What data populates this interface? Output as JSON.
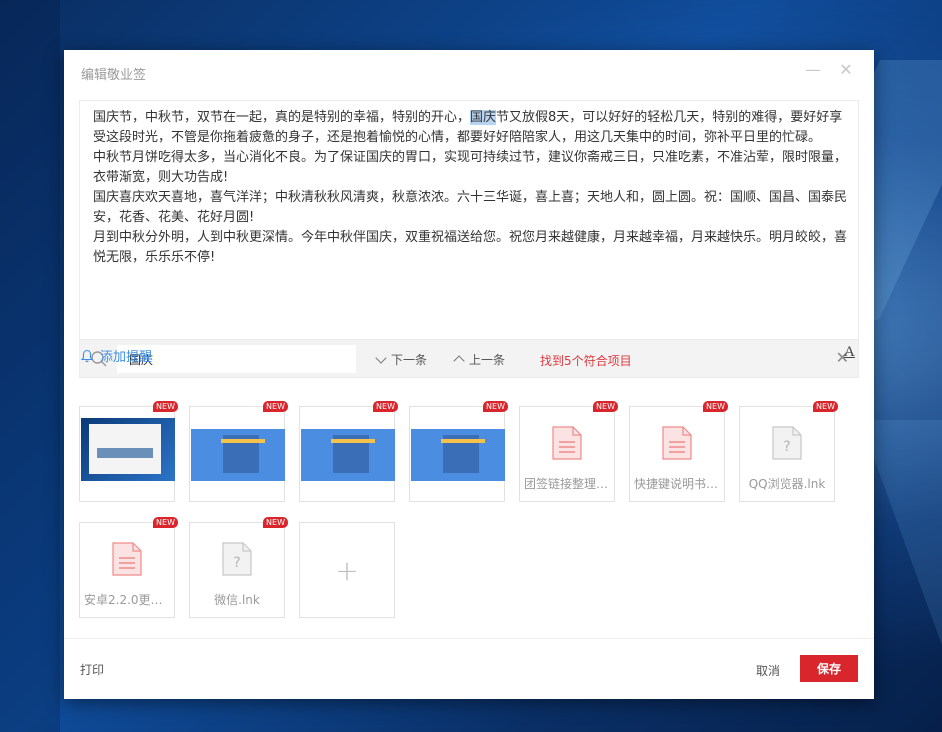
{
  "dialog": {
    "title": "编辑敬业签",
    "minimize_glyph": "—",
    "close_glyph": "✕"
  },
  "note": {
    "paragraphs": [
      {
        "before": "国庆节，中秋节，双节在一起，真的是特别的幸福，特别的开心，",
        "highlight": "国庆",
        "after": "节又放假8天，可以好好的轻松几天，特别的难得，要好好享受这段时光，不管是你拖着疲惫的身子，还是抱着愉悦的心情，都要好好陪陪家人，用这几天集中的时间，弥补平日里的忙碌。"
      },
      {
        "text": "中秋节月饼吃得太多，当心消化不良。为了保证国庆的胃口，实现可持续过节，建议你斋戒三日，只准吃素，不准沾荤，限时限量，衣带渐宽，则大功告成!"
      },
      {
        "text": "国庆喜庆欢天喜地，喜气洋洋；中秋清秋秋风清爽，秋意浓浓。六十三华诞，喜上喜；天地人和，圆上圆。祝：国顺、国昌、国泰民安，花香、花美、花好月圆!"
      },
      {
        "text": "月到中秋分外明，人到中秋更深情。今年中秋伴国庆，双重祝福送给您。祝您月来越健康，月来越幸福，月来越快乐。明月皎皎，喜悦无限，乐乐乐不停!"
      }
    ]
  },
  "find": {
    "query": "国庆",
    "next_label": "下一条",
    "prev_label": "上一条",
    "result": "找到5个符合项目",
    "close_glyph": "✕"
  },
  "reminder": {
    "label": "添加提醒"
  },
  "font_button": {
    "label": "A"
  },
  "attachments": [
    {
      "kind": "screenshot",
      "badge": "NEW",
      "name": ""
    },
    {
      "kind": "webpage",
      "badge": "NEW",
      "name": ""
    },
    {
      "kind": "webpage",
      "badge": "NEW",
      "name": ""
    },
    {
      "kind": "webpage",
      "badge": "NEW",
      "name": ""
    },
    {
      "kind": "doc",
      "badge": "NEW",
      "name": "团签链接整理...."
    },
    {
      "kind": "doc",
      "badge": "NEW",
      "name": "快捷键说明书...."
    },
    {
      "kind": "unknown",
      "badge": "NEW",
      "name": "QQ浏览器.lnk"
    },
    {
      "kind": "doc",
      "badge": "NEW",
      "name": "安卓2.2.0更新..."
    },
    {
      "kind": "unknown",
      "badge": "NEW",
      "name": "微信.lnk"
    }
  ],
  "add_attachment": {
    "glyph": "+"
  },
  "footer": {
    "print_label": "打印",
    "cancel_label": "取消",
    "save_label": "保存"
  },
  "colors": {
    "accent_red": "#d9262c",
    "link_blue": "#3d8ee0",
    "highlight": "#b9d4f2"
  }
}
